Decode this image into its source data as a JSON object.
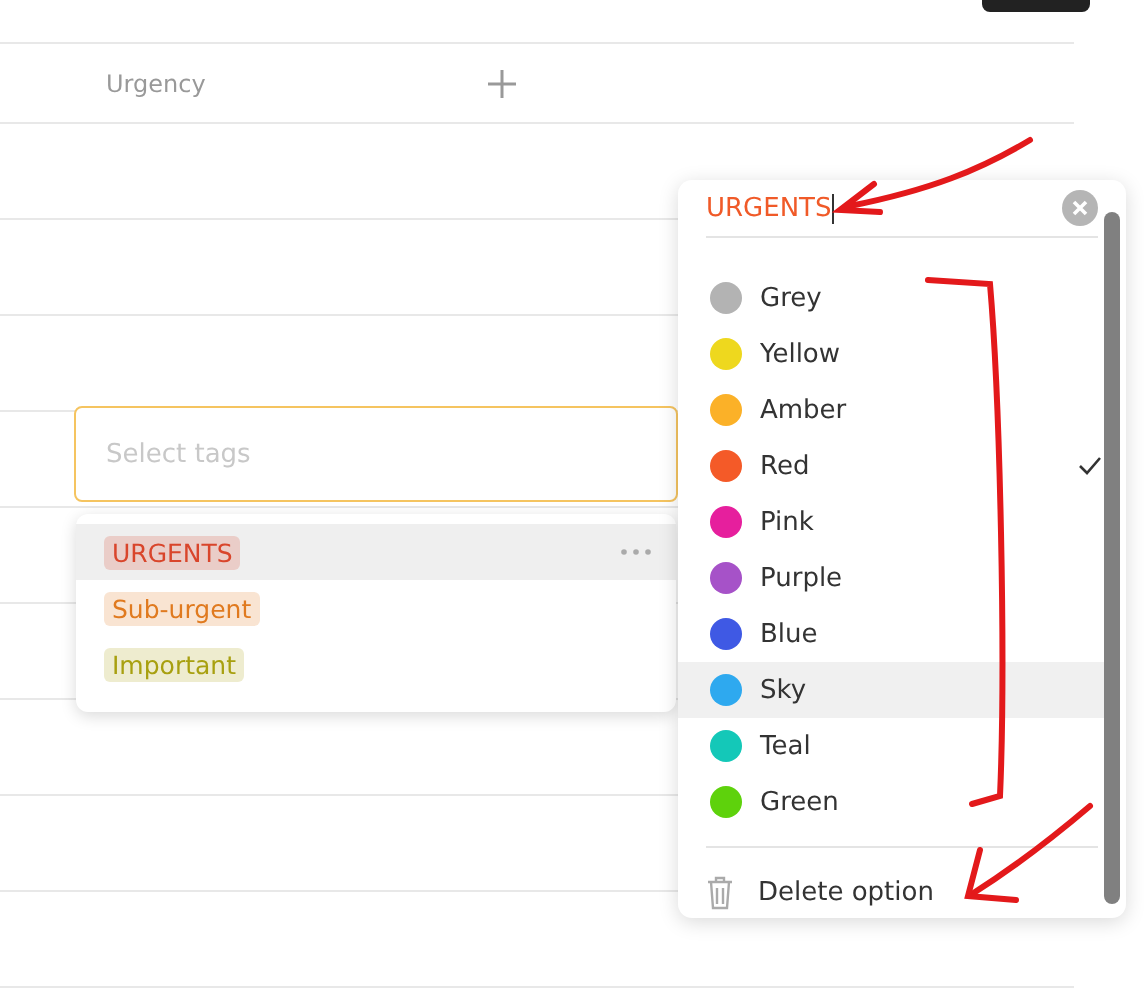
{
  "table": {
    "column_label": "Urgency"
  },
  "tag_select": {
    "placeholder": "Select tags",
    "options": [
      {
        "label": "URGENTS",
        "color": "#d9452b",
        "highlighted": true
      },
      {
        "label": "Sub-urgent",
        "color": "#e07a1f",
        "highlighted": false
      },
      {
        "label": "Important",
        "color": "#a8a010",
        "highlighted": false
      }
    ]
  },
  "option_editor": {
    "name_value": "URGENTS",
    "colors": [
      {
        "label": "Grey",
        "color": "#b3b3b3",
        "selected": false,
        "highlighted": false
      },
      {
        "label": "Yellow",
        "color": "#eed81e",
        "selected": false,
        "highlighted": false
      },
      {
        "label": "Amber",
        "color": "#fbb128",
        "selected": false,
        "highlighted": false
      },
      {
        "label": "Red",
        "color": "#f45a28",
        "selected": true,
        "highlighted": false
      },
      {
        "label": "Pink",
        "color": "#e61f9d",
        "selected": false,
        "highlighted": false
      },
      {
        "label": "Purple",
        "color": "#a652c8",
        "selected": false,
        "highlighted": false
      },
      {
        "label": "Blue",
        "color": "#3f59e4",
        "selected": false,
        "highlighted": false
      },
      {
        "label": "Sky",
        "color": "#2ea9ef",
        "selected": false,
        "highlighted": true
      },
      {
        "label": "Teal",
        "color": "#14c8b8",
        "selected": false,
        "highlighted": false
      },
      {
        "label": "Green",
        "color": "#5ed20c",
        "selected": false,
        "highlighted": false
      }
    ],
    "delete_label": "Delete option"
  }
}
